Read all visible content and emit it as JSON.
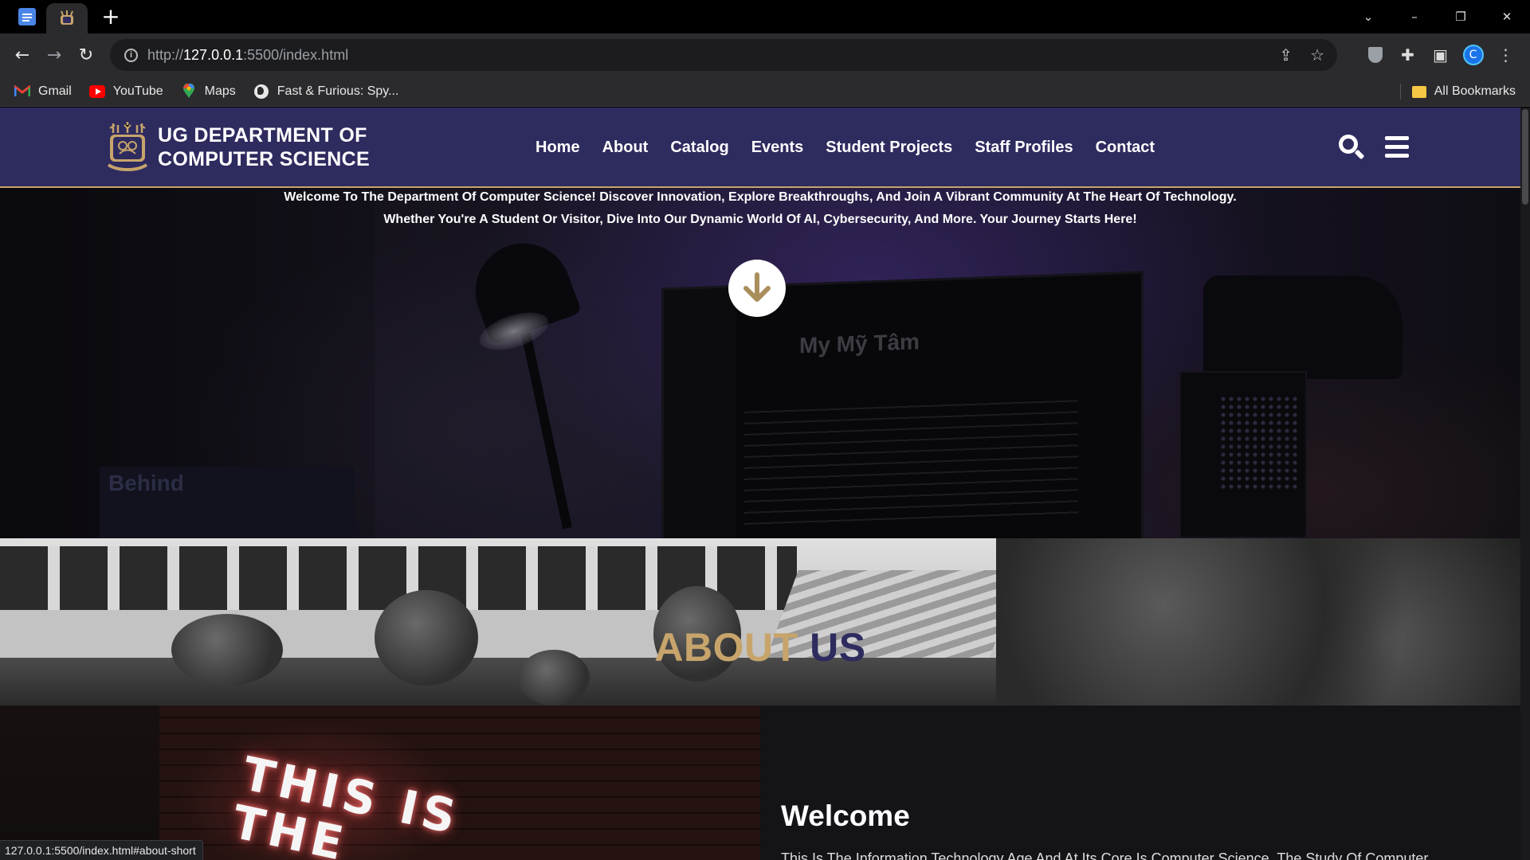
{
  "browser": {
    "active_tab_icon": "crest-icon",
    "pinned_tab_icon": "docs-icon",
    "new_tab_glyph": "+",
    "window_controls": [
      "⌄",
      "–",
      "❐",
      "✕"
    ],
    "back_glyph": "←",
    "forward_glyph": "→",
    "reload_glyph": "↻",
    "url_scheme": "http://",
    "url_host": "127.0.0.1",
    "url_rest": ":5500/index.html",
    "share_glyph": "⇪",
    "star_glyph": "☆",
    "puzzle_glyph": "✚",
    "sidepanel_glyph": "▣",
    "menu_glyph": "⋮",
    "profile_initial": "C",
    "bookmarks": [
      {
        "label": "Gmail",
        "icon": "gmail-icon"
      },
      {
        "label": "YouTube",
        "icon": "youtube-icon"
      },
      {
        "label": "Maps",
        "icon": "maps-icon"
      },
      {
        "label": "Fast & Furious: Spy...",
        "icon": "globe-icon"
      }
    ],
    "all_bookmarks_label": "All Bookmarks",
    "status_url": "127.0.0.1:5500/index.html#about-short"
  },
  "site": {
    "logo_line1": "UG DEPARTMENT OF",
    "logo_line2": "COMPUTER SCIENCE",
    "nav": [
      "Home",
      "About",
      "Catalog",
      "Events",
      "Student Projects",
      "Staff Profiles",
      "Contact"
    ],
    "welcome_line1": "Welcome To The Department Of Computer Science! Discover Innovation, Explore Breakthroughs, And Join A Vibrant Community At The Heart Of Technology.",
    "welcome_line2": "Whether You're A Student Or Visitor, Dive Into Our Dynamic World Of AI, Cybersecurity, And More. Your Journey Starts Here!",
    "hero_screen_text": "My Mỹ Tâm",
    "hero_book_text": "Behind",
    "about_word1": "ABOUT",
    "about_word2": "US",
    "neon_line1": "THIS IS",
    "neon_line2": "THE",
    "welcome_heading": "Welcome",
    "welcome_body": "This Is The Information Technology Age And At Its Core Is Computer Science. The Study Of Computer"
  },
  "colors": {
    "header_bg": "#2e2b5f",
    "accent_gold": "#c7a46b",
    "about_word2": "#2e2b5f"
  }
}
